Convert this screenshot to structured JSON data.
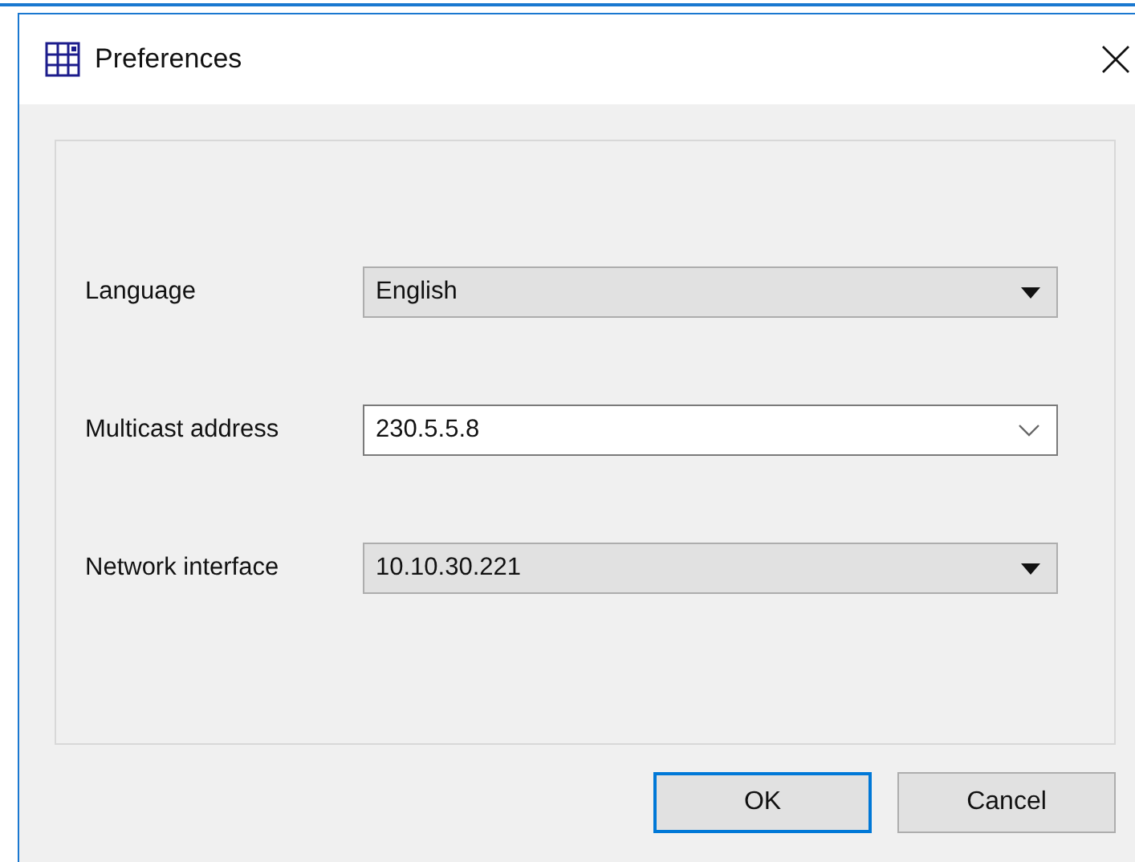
{
  "window": {
    "title": "Preferences"
  },
  "fields": [
    {
      "label": "Language",
      "value": "English",
      "kind": "dropdown"
    },
    {
      "label": "Multicast address",
      "value": "230.5.5.8",
      "kind": "editable"
    },
    {
      "label": "Network interface",
      "value": "10.10.30.221",
      "kind": "dropdown"
    }
  ],
  "buttons": [
    {
      "label": "OK",
      "default": true
    },
    {
      "label": "Cancel",
      "default": false
    }
  ]
}
